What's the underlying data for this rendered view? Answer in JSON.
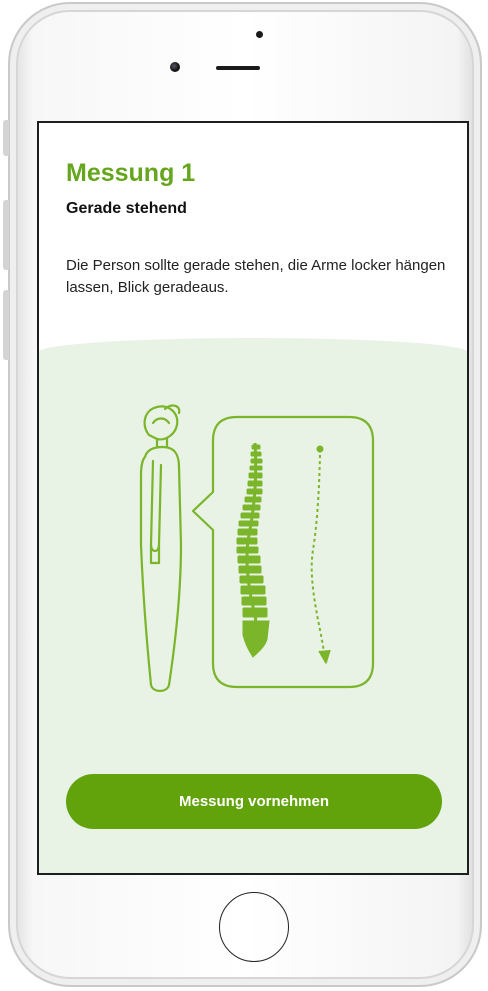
{
  "screen": {
    "title": "Messung 1",
    "subtitle": "Gerade stehend",
    "description": "Die Person sollte gerade stehen, die Arme locker hängen lassen, Blick geradeaus.",
    "primary_button_label": "Messung vornehmen"
  },
  "illustration": {
    "person_icon": "person-standing-outline-icon",
    "speech_bubble_icon": "speech-bubble-icon",
    "spine_icon": "spine-icon",
    "curve_arrow_icon": "dashed-curve-arrow-icon"
  },
  "colors": {
    "accent": "#66a61e",
    "button": "#62a30b",
    "illustration_bg": "#e8f2e5",
    "illustration_stroke": "#7ab52a"
  }
}
